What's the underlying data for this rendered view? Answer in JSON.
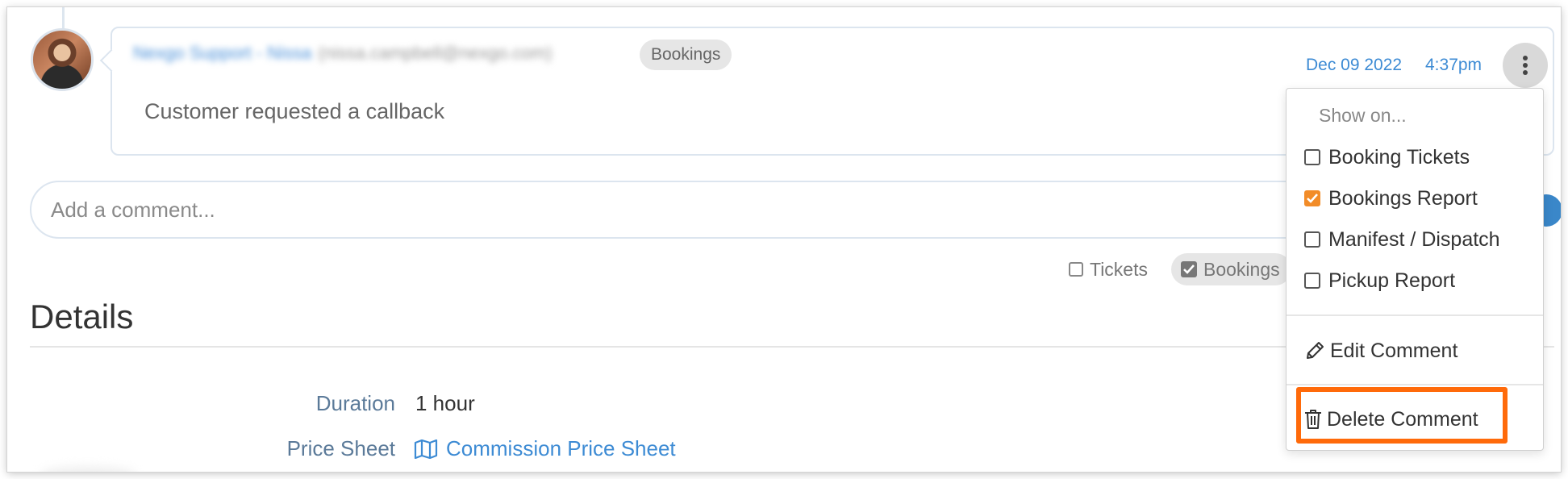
{
  "comment": {
    "author_name": "Nexgo Support - Nissa",
    "author_email": "(nissa.campbell@nexgo.com)",
    "badge": "Bookings",
    "date": "Dec 09 2022",
    "time": "4:37pm",
    "text": "Customer requested a callback"
  },
  "new_comment": {
    "placeholder": "Add a comment...",
    "value": ""
  },
  "visibility_toggles": {
    "tickets_label": "Tickets",
    "bookings_label": "Bookings"
  },
  "dropdown": {
    "header": "Show on...",
    "options": [
      {
        "label": "Booking Tickets",
        "checked": false
      },
      {
        "label": "Bookings Report",
        "checked": true
      },
      {
        "label": "Manifest / Dispatch",
        "checked": false
      },
      {
        "label": "Pickup Report",
        "checked": false
      }
    ],
    "edit_label": "Edit Comment",
    "delete_label": "Delete Comment"
  },
  "details": {
    "title": "Details",
    "duration_label": "Duration",
    "duration_value": "1 hour",
    "price_sheet_label": "Price Sheet",
    "price_sheet_value": "Commission Price Sheet"
  },
  "colors": {
    "accent_blue": "#3d8bd4",
    "check_orange": "#f28c28",
    "highlight_orange": "#ff6a0a"
  },
  "icons": [
    "more-vertical-icon",
    "checkbox-icon",
    "pencil-icon",
    "trash-icon",
    "map-icon"
  ]
}
